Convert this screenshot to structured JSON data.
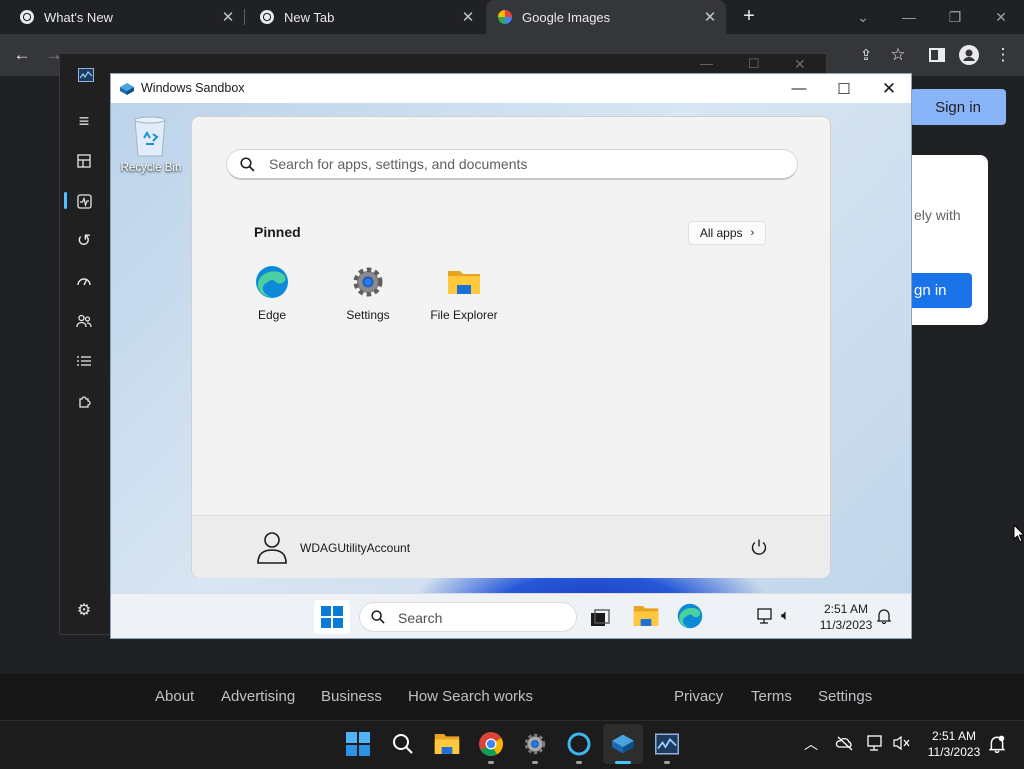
{
  "browser": {
    "tabs": [
      {
        "title": "What's New",
        "icon": "chrome-icon",
        "active": false
      },
      {
        "title": "New Tab",
        "icon": "chrome-icon",
        "active": false
      },
      {
        "title": "Google Images",
        "icon": "google-icon",
        "active": true
      }
    ],
    "new_tab_icon": "plus-icon"
  },
  "page": {
    "sign_in_label": "Sign in",
    "card_text": "ely with",
    "card_button_label": "gn in",
    "footer_links": [
      "About",
      "Advertising",
      "Business",
      "How Search works",
      "Privacy",
      "Terms",
      "Settings"
    ]
  },
  "sandbox": {
    "title": "Windows Sandbox",
    "desktop_icon_label": "Recycle Bin",
    "start_menu": {
      "search_placeholder": "Search for apps, settings, and documents",
      "pinned_label": "Pinned",
      "all_apps_label": "All apps",
      "pinned_apps": [
        "Edge",
        "Settings",
        "File Explorer"
      ],
      "account_name": "WDAGUtilityAccount"
    },
    "taskbar": {
      "search_placeholder": "Search",
      "time": "2:51 AM",
      "date": "11/3/2023"
    }
  },
  "host_taskbar": {
    "time": "2:51 AM",
    "date": "11/3/2023"
  },
  "colors": {
    "accent": "#8ab4f8",
    "sign_in_blue": "#1a73e8",
    "windows_blue": "#0078d4"
  }
}
